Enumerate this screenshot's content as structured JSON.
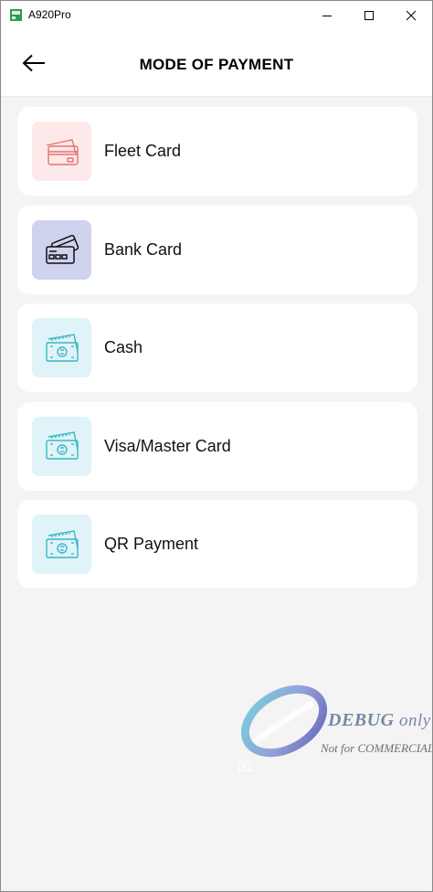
{
  "window": {
    "title": "A920Pro"
  },
  "header": {
    "title": "MODE OF PAYMENT"
  },
  "payment_methods": [
    {
      "label": "Fleet Card",
      "icon": "credit-card-icon",
      "icon_color": "#e57373"
    },
    {
      "label": "Bank Card",
      "icon": "bank-card-icon",
      "icon_color": "#111111"
    },
    {
      "label": "Cash",
      "icon": "cash-icon",
      "icon_color": "#3bb8c4"
    },
    {
      "label": "Visa/Master Card",
      "icon": "cash-icon",
      "icon_color": "#3bb8c4"
    },
    {
      "label": "QR Payment",
      "icon": "cash-icon",
      "icon_color": "#3bb8c4"
    }
  ],
  "watermark": {
    "line1": "DEBUG",
    "line1_suffix": "only",
    "line2": "Not for COMMERCIAL",
    "mark": "01"
  }
}
